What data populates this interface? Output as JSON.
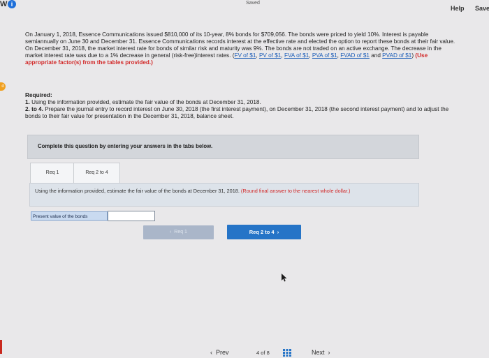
{
  "header": {
    "logo": "W",
    "info_icon": "i",
    "status": "Saved",
    "help_label": "Help",
    "save_label": "Save"
  },
  "sidebar": {
    "tab_letter": "d"
  },
  "problem": {
    "text_1": "On January 1, 2018, Essence Communications issued $810,000 of its 10-year, 8% bonds for $709,056. The bonds were priced to yield 10%. Interest is payable semiannually on June 30 and December 31. Essence Communications records interest at the effective rate and elected the option to report these bonds at their fair value. On December 31, 2018, the market interest rate for bonds of similar risk and maturity was 9%. The bonds are not traded on an active exchange. The decrease in the market interest rate was due to a 1% decrease in general (risk-free)interest rates. (",
    "links": [
      "FV of $1",
      "PV of $1",
      "FVA of $1",
      "PVA of $1",
      "FVAD of $1",
      "PVAD of $1"
    ],
    "text_2": ") ",
    "red_text": "(Use appropriate factor(s) from the tables provided.)"
  },
  "required": {
    "heading": "Required:",
    "item1_num": "1.",
    "item1_text": " Using the information provided, estimate the fair value of the bonds at December 31, 2018.",
    "item2_num": "2. to 4.",
    "item2_text": " Prepare the journal entry to record interest on June 30, 2018 (the first interest payment), on December 31, 2018 (the second interest payment) and to adjust the bonds to their fair value for presentation in the December 31, 2018, balance sheet."
  },
  "instructions": "Complete this question by entering your answers in the tabs below.",
  "tabs": [
    {
      "label": "Req 1"
    },
    {
      "label": "Req 2 to 4"
    }
  ],
  "panel": {
    "text": "Using the information provided, estimate the fair value of the bonds at December 31, 2018. ",
    "red_text": "(Round final answer to the nearest whole dollar.)"
  },
  "answer": {
    "label": "Present value of the bonds",
    "value": ""
  },
  "nav": {
    "prev_req": "Req 1",
    "next_req": "Req 2 to 4"
  },
  "footer": {
    "prev_label": "Prev",
    "page_current": "4",
    "page_of": "of",
    "page_total": "8",
    "next_label": "Next"
  },
  "colors": {
    "accent_blue": "#2574c7",
    "warning_red": "#d22a2a",
    "link_blue": "#1c5db8"
  }
}
